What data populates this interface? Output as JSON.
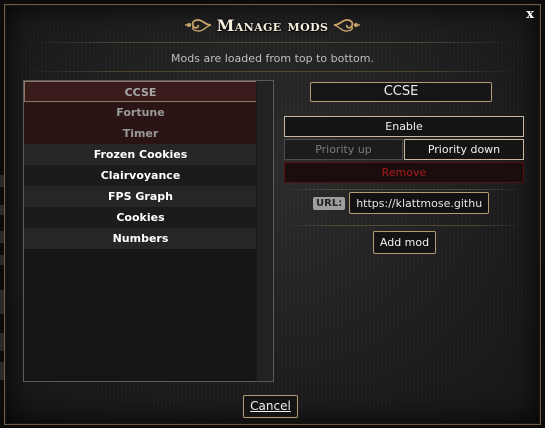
{
  "dialog": {
    "title": "Manage mods",
    "subtitle": "Mods are loaded from top to bottom.",
    "close_label": "x"
  },
  "mods": [
    {
      "name": "CCSE",
      "state": "disabled-selected"
    },
    {
      "name": "Fortune",
      "state": "disabled"
    },
    {
      "name": "Timer",
      "state": "disabled"
    },
    {
      "name": "Frozen Cookies",
      "state": "enabled"
    },
    {
      "name": "Clairvoyance",
      "state": "enabled"
    },
    {
      "name": "FPS Graph",
      "state": "enabled"
    },
    {
      "name": "Cookies",
      "state": "enabled"
    },
    {
      "name": "Numbers",
      "state": "enabled"
    }
  ],
  "details": {
    "selected_mod": "CCSE",
    "enable_label": "Enable",
    "priority_up_label": "Priority up",
    "priority_down_label": "Priority down",
    "remove_label": "Remove"
  },
  "url_row": {
    "label": "URL:",
    "value": "https://klattmose.github.io"
  },
  "add_mod_label": "Add mod",
  "cancel_label": "Cancel",
  "colors": {
    "border_gold": "#b59a72",
    "remove_red": "#a51b1b",
    "disabled_row_bg": "#2a1414"
  }
}
